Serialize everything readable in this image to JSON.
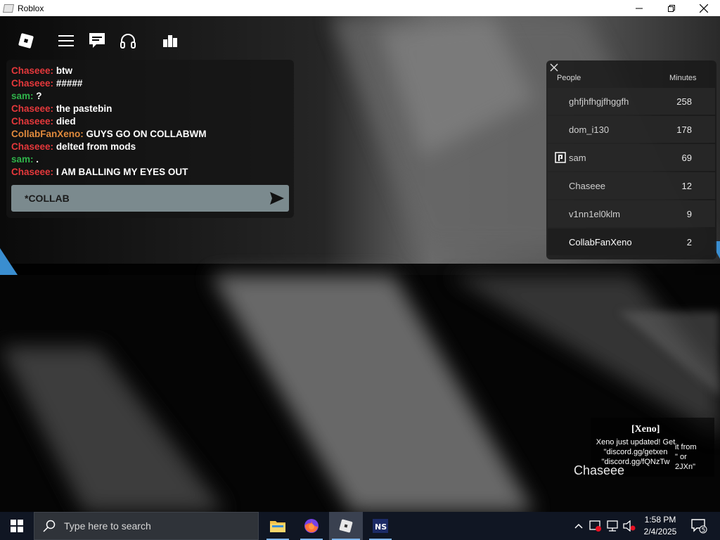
{
  "window": {
    "title": "Roblox",
    "controls": [
      "minimize",
      "restore",
      "close"
    ]
  },
  "topbar": {
    "icons": [
      "roblox-logo-icon",
      "menu-icon",
      "chat-icon",
      "headphones-icon",
      "leaderboard-icon"
    ]
  },
  "chat": {
    "messages": [
      {
        "name": "Chaseee:",
        "text": "btw",
        "color": "#e5383b"
      },
      {
        "name": "Chaseee:",
        "text": "#####",
        "color": "#e5383b"
      },
      {
        "name": "sam:",
        "text": "?",
        "color": "#2fb34a"
      },
      {
        "name": "Chaseee:",
        "text": "the pastebin",
        "color": "#e5383b"
      },
      {
        "name": "Chaseee:",
        "text": "died",
        "color": "#e5383b"
      },
      {
        "name": "CollabFanXeno:",
        "text": "GUYS GO ON COLLABWM",
        "color": "#e08a3c"
      },
      {
        "name": "Chaseee:",
        "text": "delted from mods",
        "color": "#e5383b"
      },
      {
        "name": "sam:",
        "text": ".",
        "color": "#2fb34a"
      },
      {
        "name": "Chaseee:",
        "text": "I AM BALLING MY EYES OUT",
        "color": "#e5383b"
      }
    ],
    "input_value": "*COLLAB"
  },
  "leaderboard": {
    "col_people": "People",
    "col_minutes": "Minutes",
    "rows": [
      {
        "name": "ghfjhfhgjfhggfh",
        "minutes": "258"
      },
      {
        "name": "dom_i130",
        "minutes": "178"
      },
      {
        "name": "sam",
        "minutes": "69"
      },
      {
        "name": "Chaseee",
        "minutes": "12"
      },
      {
        "name": "v1nn1el0klm",
        "minutes": "9"
      },
      {
        "name": "CollabFanXeno",
        "minutes": "2"
      }
    ]
  },
  "notification": {
    "title": "[Xeno]",
    "line1": "Xeno just updated! Get",
    "line2": "\"discord.gg/getxen",
    "line3": "\"discord.gg/fQNzTw",
    "overflow1": "it from",
    "overflow2": "\" or",
    "overflow3": "2JXn\""
  },
  "player_tag": "Chaseee",
  "taskbar": {
    "search_placeholder": "Type here to search",
    "time": "1:58 PM",
    "date": "2/4/2025",
    "notification_count": "5",
    "accent": "#7eb4ea"
  }
}
